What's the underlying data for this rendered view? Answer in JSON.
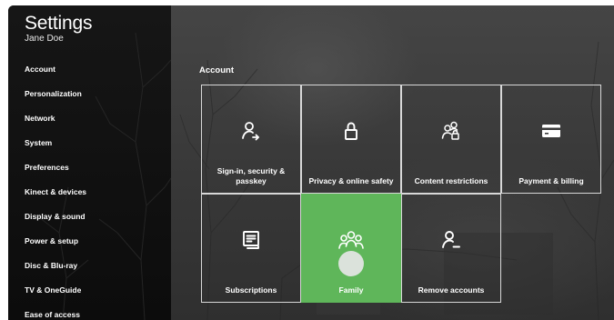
{
  "header": {
    "title": "Settings",
    "user_name": "Jane Doe"
  },
  "sidebar": {
    "items": [
      {
        "label": "Account"
      },
      {
        "label": "Personalization"
      },
      {
        "label": "Network"
      },
      {
        "label": "System"
      },
      {
        "label": "Preferences"
      },
      {
        "label": "Kinect & devices"
      },
      {
        "label": "Display  & sound"
      },
      {
        "label": "Power & setup"
      },
      {
        "label": "Disc & Blu-ray"
      },
      {
        "label": "TV & OneGuide"
      },
      {
        "label": "Ease of access"
      }
    ]
  },
  "main": {
    "section_title": "Account",
    "tiles": [
      {
        "label": "Sign-in, security & passkey",
        "icon": "user-arrow-icon"
      },
      {
        "label": "Privacy & online safety",
        "icon": "lock-icon"
      },
      {
        "label": "Content restrictions",
        "icon": "user-lock-icon"
      },
      {
        "label": "Payment & billing",
        "icon": "credit-card-icon"
      },
      {
        "label": "Subscriptions",
        "icon": "subscriptions-icon"
      },
      {
        "label": "Family",
        "icon": "family-icon",
        "selected": true
      },
      {
        "label": "Remove accounts",
        "icon": "remove-user-icon"
      }
    ]
  },
  "colors": {
    "accent": "#5fb65a",
    "sidebar_bg": "#111111",
    "content_bg": "#3a3a3a",
    "tile_border": "#d8d8d8",
    "text": "#ffffff"
  }
}
